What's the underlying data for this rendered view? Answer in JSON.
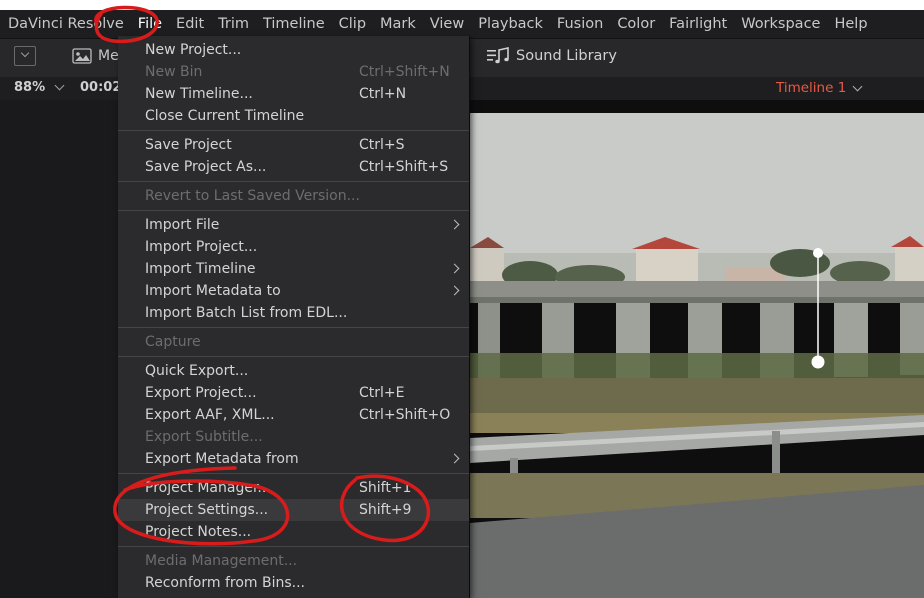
{
  "menubar": {
    "app": "DaVinci Resolve",
    "items": [
      "File",
      "Edit",
      "Trim",
      "Timeline",
      "Clip",
      "Mark",
      "View",
      "Playback",
      "Fusion",
      "Color",
      "Fairlight",
      "Workspace",
      "Help"
    ]
  },
  "toolbar": {
    "media_label": "Me",
    "sound_library": "Sound Library"
  },
  "subbar": {
    "zoom": "88%",
    "timecode": "00:02:",
    "timeline_name": "Timeline 1"
  },
  "file_menu": [
    {
      "label": "New Project...",
      "shortcut": "",
      "disabled": false
    },
    {
      "label": "New Bin",
      "shortcut": "Ctrl+Shift+N",
      "disabled": true
    },
    {
      "label": "New Timeline...",
      "shortcut": "Ctrl+N",
      "disabled": false
    },
    {
      "label": "Close Current Timeline",
      "shortcut": "",
      "disabled": false
    },
    {
      "label": "Save Project",
      "shortcut": "Ctrl+S",
      "disabled": false
    },
    {
      "label": "Save Project As...",
      "shortcut": "Ctrl+Shift+S",
      "disabled": false
    },
    {
      "label": "Revert to Last Saved Version...",
      "shortcut": "",
      "disabled": true
    },
    {
      "label": "Import File",
      "shortcut": "",
      "disabled": false,
      "submenu": true
    },
    {
      "label": "Import Project...",
      "shortcut": "",
      "disabled": false
    },
    {
      "label": "Import Timeline",
      "shortcut": "",
      "disabled": false,
      "submenu": true
    },
    {
      "label": "Import Metadata to",
      "shortcut": "",
      "disabled": false,
      "submenu": true
    },
    {
      "label": "Import Batch List from EDL...",
      "shortcut": "",
      "disabled": false
    },
    {
      "label": "Capture",
      "shortcut": "",
      "disabled": true
    },
    {
      "label": "Quick Export...",
      "shortcut": "",
      "disabled": false
    },
    {
      "label": "Export Project...",
      "shortcut": "Ctrl+E",
      "disabled": false
    },
    {
      "label": "Export AAF, XML...",
      "shortcut": "Ctrl+Shift+O",
      "disabled": false
    },
    {
      "label": "Export Subtitle...",
      "shortcut": "",
      "disabled": true
    },
    {
      "label": "Export Metadata from",
      "shortcut": "",
      "disabled": false,
      "submenu": true
    },
    {
      "label": "Project Manager...",
      "shortcut": "Shift+1",
      "disabled": false
    },
    {
      "label": "Project Settings...",
      "shortcut": "Shift+9",
      "disabled": false,
      "highlighted": true
    },
    {
      "label": "Project Notes...",
      "shortcut": "",
      "disabled": false
    },
    {
      "label": "Media Management...",
      "shortcut": "",
      "disabled": true
    },
    {
      "label": "Reconform from Bins...",
      "shortcut": "",
      "disabled": false
    }
  ],
  "colors": {
    "timeline_name": "#e45a44",
    "annotation_red": "#d81b1b",
    "menu_bg": "#2b2b2d",
    "highlight_bg": "#3a3a3d"
  }
}
